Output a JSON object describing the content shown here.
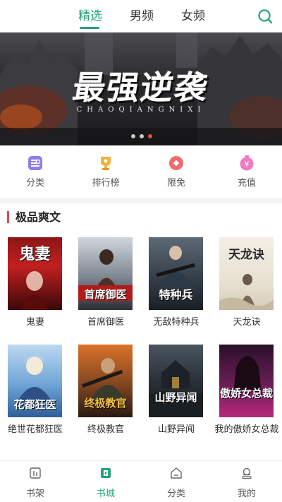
{
  "tabs": [
    {
      "label": "精选",
      "active": true
    },
    {
      "label": "男频",
      "active": false
    },
    {
      "label": "女频",
      "active": false
    }
  ],
  "search": {
    "icon": "search-icon"
  },
  "banner": {
    "title": "最强逆袭",
    "subtitle": "CHAOQIANGNIXI",
    "page_count": 3,
    "active_index": 2
  },
  "menu": [
    {
      "label": "分类",
      "icon": "category-icon",
      "color": "#8c7ee6"
    },
    {
      "label": "排行榜",
      "icon": "trophy-icon",
      "color": "#f2b33d"
    },
    {
      "label": "限免",
      "icon": "limited-free-icon",
      "color": "#f06b6b"
    },
    {
      "label": "充值",
      "icon": "recharge-icon",
      "color": "#f07ac4"
    }
  ],
  "section": {
    "title": "极品爽文",
    "books": [
      {
        "title": "鬼妻",
        "cover_text": "鬼妻"
      },
      {
        "title": "首席御医",
        "cover_text": "首席御医"
      },
      {
        "title": "无敌特种兵",
        "cover_text": "特种兵"
      },
      {
        "title": "天龙诀",
        "cover_text": "天龙诀"
      },
      {
        "title": "绝世花都狂医",
        "cover_text": "花都狂医"
      },
      {
        "title": "终极教官",
        "cover_text": "终极教官"
      },
      {
        "title": "山野异闻",
        "cover_text": "山野异闻"
      },
      {
        "title": "我的傲娇女总裁",
        "cover_text": "傲娇女总裁"
      }
    ]
  },
  "bottom_nav": [
    {
      "label": "书架",
      "icon": "bookshelf-icon",
      "active": false
    },
    {
      "label": "书城",
      "icon": "bookstore-icon",
      "active": true
    },
    {
      "label": "分类",
      "icon": "category-icon",
      "active": false
    },
    {
      "label": "我的",
      "icon": "profile-icon",
      "active": false
    }
  ],
  "colors": {
    "accent": "#22a37a",
    "section_bar": "#e04848",
    "banner_dot_active": "#e64a4a"
  }
}
